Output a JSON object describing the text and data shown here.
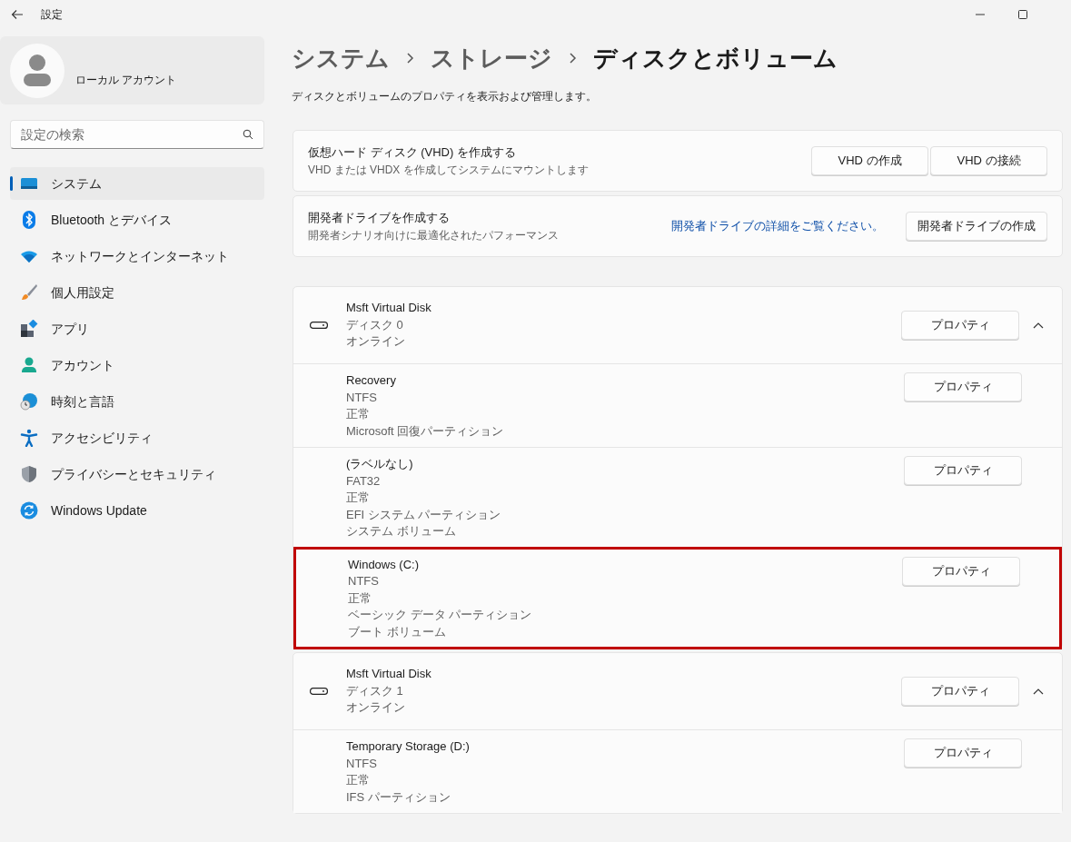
{
  "window": {
    "title": "設定"
  },
  "account": {
    "name": "ローカル アカウント"
  },
  "search": {
    "placeholder": "設定の検索"
  },
  "sidebar": {
    "items": [
      {
        "kind": "system",
        "label": "システム",
        "selected": true
      },
      {
        "kind": "bluetooth",
        "label": "Bluetooth とデバイス",
        "selected": false
      },
      {
        "kind": "network",
        "label": "ネットワークとインターネット",
        "selected": false
      },
      {
        "kind": "personalize",
        "label": "個人用設定",
        "selected": false
      },
      {
        "kind": "apps",
        "label": "アプリ",
        "selected": false
      },
      {
        "kind": "account",
        "label": "アカウント",
        "selected": false
      },
      {
        "kind": "time",
        "label": "時刻と言語",
        "selected": false
      },
      {
        "kind": "accessibility",
        "label": "アクセシビリティ",
        "selected": false
      },
      {
        "kind": "privacy",
        "label": "プライバシーとセキュリティ",
        "selected": false
      },
      {
        "kind": "update",
        "label": "Windows Update",
        "selected": false
      }
    ]
  },
  "breadcrumb": [
    "システム",
    "ストレージ",
    "ディスクとボリューム"
  ],
  "description": "ディスクとボリュームのプロパティを表示および管理します。",
  "cards": [
    {
      "title": "仮想ハード ディスク (VHD) を作成する",
      "subtitle": "VHD または VHDX を作成してシステムにマウントします",
      "buttons": [
        "VHD の作成",
        "VHD の接続"
      ]
    },
    {
      "title": "開発者ドライブを作成する",
      "subtitle": "開発者シナリオ向けに最適化されたパフォーマンス",
      "link": "開発者ドライブの詳細をご覧ください。",
      "buttons": [
        "開発者ドライブの作成"
      ]
    }
  ],
  "disks": [
    {
      "name": "Msft Virtual Disk",
      "details": [
        "ディスク 0",
        "オンライン"
      ],
      "button": "プロパティ",
      "expanded": true,
      "volumes": [
        {
          "name": "Recovery",
          "details": [
            "NTFS",
            "正常",
            "Microsoft 回復パーティション"
          ],
          "button": "プロパティ",
          "highlighted": false
        },
        {
          "name": "(ラベルなし)",
          "details": [
            "FAT32",
            "正常",
            "EFI システム パーティション",
            "システム ボリューム"
          ],
          "button": "プロパティ",
          "highlighted": false
        },
        {
          "name": "Windows (C:)",
          "details": [
            "NTFS",
            "正常",
            "ベーシック データ パーティション",
            "ブート ボリューム"
          ],
          "button": "プロパティ",
          "highlighted": true
        }
      ]
    },
    {
      "name": "Msft Virtual Disk",
      "details": [
        "ディスク 1",
        "オンライン"
      ],
      "button": "プロパティ",
      "expanded": true,
      "volumes": [
        {
          "name": "Temporary Storage (D:)",
          "details": [
            "NTFS",
            "正常",
            "IFS パーティション"
          ],
          "button": "プロパティ",
          "highlighted": false
        }
      ]
    }
  ]
}
